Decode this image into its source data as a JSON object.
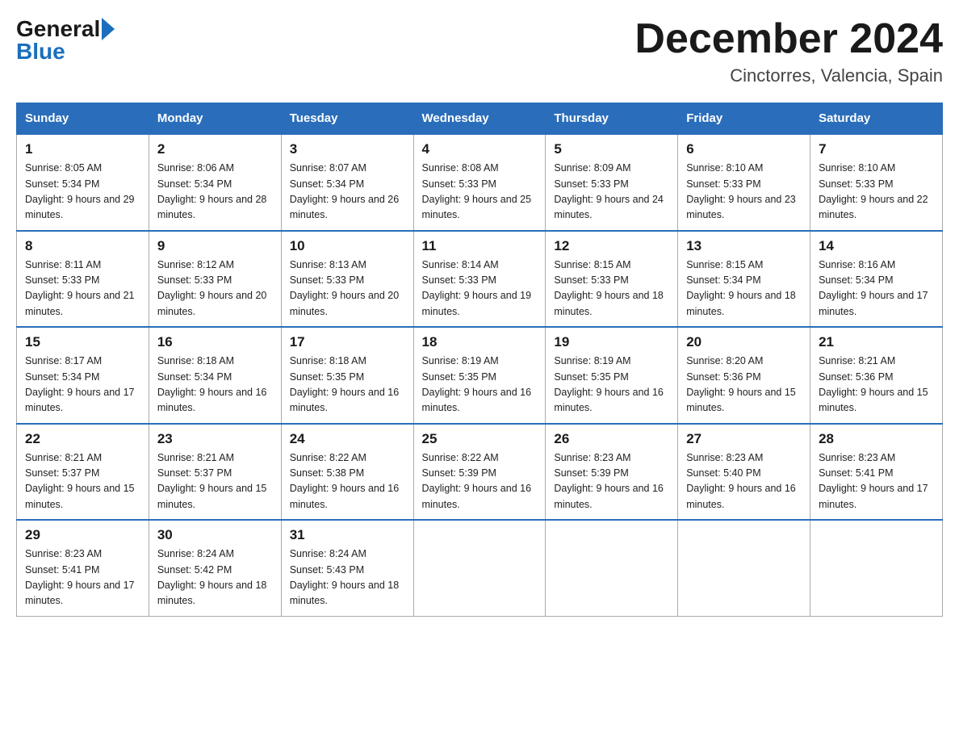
{
  "logo": {
    "general": "General",
    "blue": "Blue"
  },
  "title": "December 2024",
  "location": "Cinctorres, Valencia, Spain",
  "headers": [
    "Sunday",
    "Monday",
    "Tuesday",
    "Wednesday",
    "Thursday",
    "Friday",
    "Saturday"
  ],
  "weeks": [
    [
      {
        "num": "1",
        "sunrise": "8:05 AM",
        "sunset": "5:34 PM",
        "daylight": "9 hours and 29 minutes."
      },
      {
        "num": "2",
        "sunrise": "8:06 AM",
        "sunset": "5:34 PM",
        "daylight": "9 hours and 28 minutes."
      },
      {
        "num": "3",
        "sunrise": "8:07 AM",
        "sunset": "5:34 PM",
        "daylight": "9 hours and 26 minutes."
      },
      {
        "num": "4",
        "sunrise": "8:08 AM",
        "sunset": "5:33 PM",
        "daylight": "9 hours and 25 minutes."
      },
      {
        "num": "5",
        "sunrise": "8:09 AM",
        "sunset": "5:33 PM",
        "daylight": "9 hours and 24 minutes."
      },
      {
        "num": "6",
        "sunrise": "8:10 AM",
        "sunset": "5:33 PM",
        "daylight": "9 hours and 23 minutes."
      },
      {
        "num": "7",
        "sunrise": "8:10 AM",
        "sunset": "5:33 PM",
        "daylight": "9 hours and 22 minutes."
      }
    ],
    [
      {
        "num": "8",
        "sunrise": "8:11 AM",
        "sunset": "5:33 PM",
        "daylight": "9 hours and 21 minutes."
      },
      {
        "num": "9",
        "sunrise": "8:12 AM",
        "sunset": "5:33 PM",
        "daylight": "9 hours and 20 minutes."
      },
      {
        "num": "10",
        "sunrise": "8:13 AM",
        "sunset": "5:33 PM",
        "daylight": "9 hours and 20 minutes."
      },
      {
        "num": "11",
        "sunrise": "8:14 AM",
        "sunset": "5:33 PM",
        "daylight": "9 hours and 19 minutes."
      },
      {
        "num": "12",
        "sunrise": "8:15 AM",
        "sunset": "5:33 PM",
        "daylight": "9 hours and 18 minutes."
      },
      {
        "num": "13",
        "sunrise": "8:15 AM",
        "sunset": "5:34 PM",
        "daylight": "9 hours and 18 minutes."
      },
      {
        "num": "14",
        "sunrise": "8:16 AM",
        "sunset": "5:34 PM",
        "daylight": "9 hours and 17 minutes."
      }
    ],
    [
      {
        "num": "15",
        "sunrise": "8:17 AM",
        "sunset": "5:34 PM",
        "daylight": "9 hours and 17 minutes."
      },
      {
        "num": "16",
        "sunrise": "8:18 AM",
        "sunset": "5:34 PM",
        "daylight": "9 hours and 16 minutes."
      },
      {
        "num": "17",
        "sunrise": "8:18 AM",
        "sunset": "5:35 PM",
        "daylight": "9 hours and 16 minutes."
      },
      {
        "num": "18",
        "sunrise": "8:19 AM",
        "sunset": "5:35 PM",
        "daylight": "9 hours and 16 minutes."
      },
      {
        "num": "19",
        "sunrise": "8:19 AM",
        "sunset": "5:35 PM",
        "daylight": "9 hours and 16 minutes."
      },
      {
        "num": "20",
        "sunrise": "8:20 AM",
        "sunset": "5:36 PM",
        "daylight": "9 hours and 15 minutes."
      },
      {
        "num": "21",
        "sunrise": "8:21 AM",
        "sunset": "5:36 PM",
        "daylight": "9 hours and 15 minutes."
      }
    ],
    [
      {
        "num": "22",
        "sunrise": "8:21 AM",
        "sunset": "5:37 PM",
        "daylight": "9 hours and 15 minutes."
      },
      {
        "num": "23",
        "sunrise": "8:21 AM",
        "sunset": "5:37 PM",
        "daylight": "9 hours and 15 minutes."
      },
      {
        "num": "24",
        "sunrise": "8:22 AM",
        "sunset": "5:38 PM",
        "daylight": "9 hours and 16 minutes."
      },
      {
        "num": "25",
        "sunrise": "8:22 AM",
        "sunset": "5:39 PM",
        "daylight": "9 hours and 16 minutes."
      },
      {
        "num": "26",
        "sunrise": "8:23 AM",
        "sunset": "5:39 PM",
        "daylight": "9 hours and 16 minutes."
      },
      {
        "num": "27",
        "sunrise": "8:23 AM",
        "sunset": "5:40 PM",
        "daylight": "9 hours and 16 minutes."
      },
      {
        "num": "28",
        "sunrise": "8:23 AM",
        "sunset": "5:41 PM",
        "daylight": "9 hours and 17 minutes."
      }
    ],
    [
      {
        "num": "29",
        "sunrise": "8:23 AM",
        "sunset": "5:41 PM",
        "daylight": "9 hours and 17 minutes."
      },
      {
        "num": "30",
        "sunrise": "8:24 AM",
        "sunset": "5:42 PM",
        "daylight": "9 hours and 18 minutes."
      },
      {
        "num": "31",
        "sunrise": "8:24 AM",
        "sunset": "5:43 PM",
        "daylight": "9 hours and 18 minutes."
      },
      null,
      null,
      null,
      null
    ]
  ]
}
